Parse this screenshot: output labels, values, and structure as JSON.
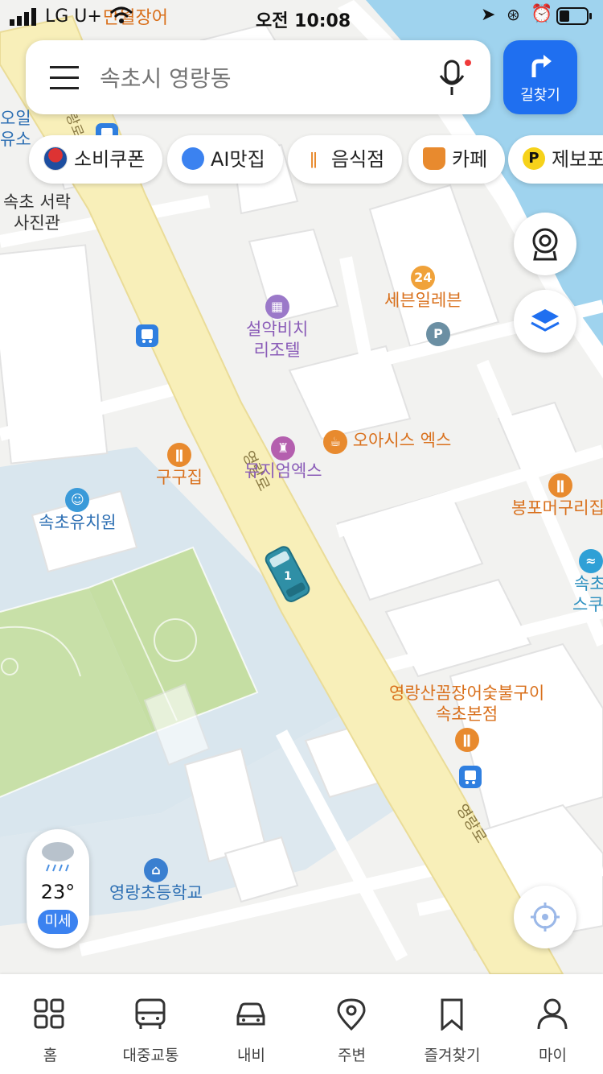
{
  "status_bar": {
    "carrier": "LG U+",
    "time": "오전 10:08"
  },
  "search": {
    "placeholder": "속초시 영랑동"
  },
  "route_button": {
    "label": "길찾기"
  },
  "chips": [
    {
      "label": "소비쿠폰",
      "icon": "korea-flag-icon"
    },
    {
      "label": "AI맛집",
      "icon": "compass-icon"
    },
    {
      "label": "음식점",
      "icon": "restaurant-icon"
    },
    {
      "label": "카페",
      "icon": "cafe-icon"
    },
    {
      "label": "제보포",
      "icon": "p-badge-icon"
    }
  ],
  "map": {
    "labels": {
      "top_partial": "만월장어",
      "place_oil": "오일",
      "place_oil2": "유소",
      "seorak_photo_1": "속초 서락",
      "seorak_photo_2": "사진관",
      "seven_eleven": "세븐일레븐",
      "seorak_beach_1": "설악비치",
      "seorak_beach_2": "리조텔",
      "oasis": "오아시스 엑스",
      "museum": "뮤지엄엑스",
      "gugujip": "구구집",
      "kindergarten": "속초유치원",
      "bongpo": "봉포머구리집",
      "scuba_1": "속초",
      "scuba_2": "스쿠버",
      "eel_1": "영랑산꼼장어숯불구이",
      "eel_2": "속초본점",
      "school": "영랑초등학교",
      "road_1": "영랑로",
      "road_2": "영랑로",
      "road_3": "영랑로",
      "bus_number": "1"
    },
    "colors": {
      "road": "#f8efb9",
      "water": "#9fd3ee",
      "park": "#c8e0a8",
      "school_area": "#d9e6ee",
      "poi_orange": "#d9701c",
      "poi_purple": "#8a5cb8",
      "bus_stop_blue": "#2f7fe0"
    }
  },
  "weather": {
    "temperature": "23°",
    "dust_label": "미세",
    "icon": "rain-cloud-icon"
  },
  "tabs": [
    {
      "label": "홈",
      "icon": "home-grid-icon"
    },
    {
      "label": "대중교통",
      "icon": "bus-icon"
    },
    {
      "label": "내비",
      "icon": "car-icon"
    },
    {
      "label": "주변",
      "icon": "location-pin-icon"
    },
    {
      "label": "즐겨찾기",
      "icon": "bookmark-icon"
    },
    {
      "label": "마이",
      "icon": "person-icon"
    }
  ]
}
